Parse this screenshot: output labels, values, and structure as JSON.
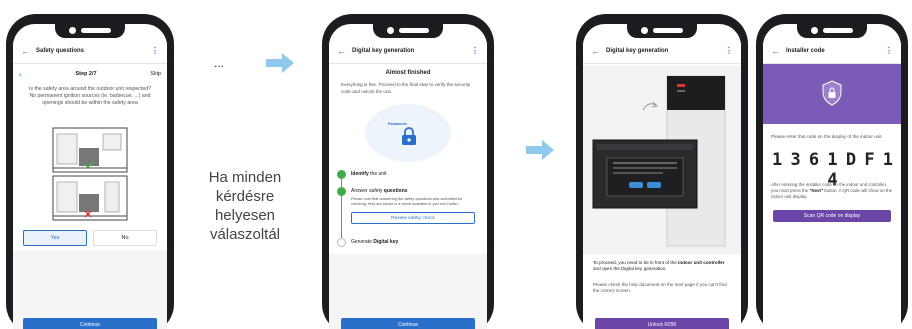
{
  "phone1": {
    "title": "Safety questions",
    "step_label": "Step 2/7",
    "skip_label": "Skip",
    "question": "Is the safety area around the outdoor unit respected? No permanent ignition sources (ie. barbecue, ...) and openings should be within the safety area",
    "yes_label": "Yes",
    "no_label": "No",
    "continue_label": "Continue"
  },
  "ellipsis": "...",
  "caption": [
    "Ha minden",
    "kérdésre",
    "helyesen",
    "válaszoltál"
  ],
  "phone2": {
    "title": "Digital key generation",
    "heading": "Almost finished",
    "intro": "Everything is fine. Proceed to the final step to verify the security code and unlock the unit.",
    "brand": "Panasonic",
    "steps": [
      {
        "label": "Identify",
        "suffix": " the unit"
      },
      {
        "label": "Answer safety ",
        "suffix": "questions"
      },
      {
        "label": "Generate ",
        "suffix": "Digital key"
      }
    ],
    "step_note": "Please note that answering the safety questions was submitted for checking; they are saved in a report available to you and Daikin.",
    "review_label": "Review safety check",
    "continue_label": "Continue"
  },
  "phone3": {
    "title": "Digital key generation",
    "text1_a": "To proceed, you need to be in front of the ",
    "text1_b": "indoor unit controller",
    "text1_c": " and open the Digital key generation.",
    "text2": "Please check the help document on the next page if you can't find the correct screen.",
    "unlock_label": "Unlock R290"
  },
  "phone4": {
    "title": "Installer code",
    "instruction": "Please enter this code on the display of the indoor unit.",
    "code": "1 3 6 1 D F 1 4",
    "note_a": "After entering the installer code on the indoor unit controller, you must press the ",
    "note_b": "\"Next\"",
    "note_c": " button. A QR code will show on the indoor unit display.",
    "scan_label": "Scan QR code on display"
  },
  "colors": {
    "accent": "#2a6fc9",
    "purple": "#6b46a8",
    "success": "#3fae49",
    "arrow": "#8fc9ec"
  }
}
